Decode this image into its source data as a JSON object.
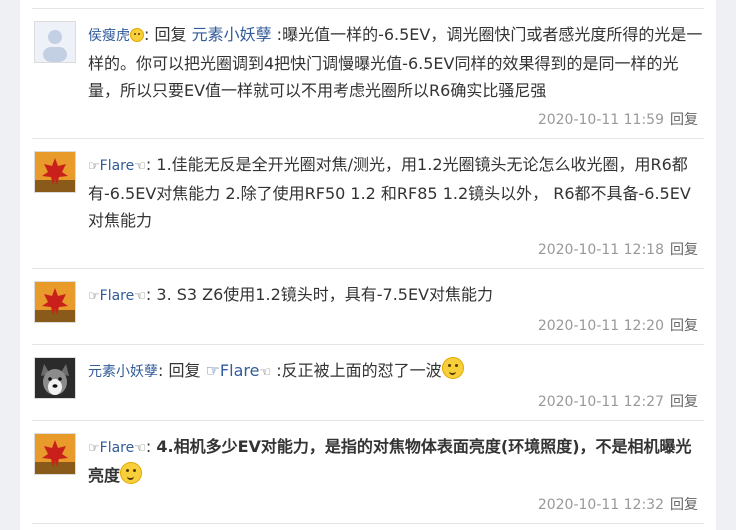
{
  "replies": [
    {
      "user": "侯瘦虎",
      "separator": ": ",
      "reply_word": "回复 ",
      "reply_target": "元素小妖孽",
      "text": " :曝光值一样的-6.5EV，调光圈快门或者感光度所得的光是一样的。你可以把光圈调到4把快门调慢曝光值-6.5EV同样的效果得到的是同一样的光量，所以只要EV值一样就可以不用考虑光圈所以R6确实比骚尼强",
      "timestamp": "2020-10-11 11:59",
      "reply_label": "回复"
    },
    {
      "user_prefix": "☞",
      "user": "Flare",
      "user_suffix": "☜",
      "separator": ": ",
      "text": "1.佳能无反是全开光圈对焦/测光，用1.2光圈镜头无论怎么收光圈，用R6都有-6.5EV对焦能力 2.除了使用RF50 1.2 和RF85 1.2镜头以外， R6都不具备-6.5EV对焦能力",
      "timestamp": "2020-10-11 12:18",
      "reply_label": "回复"
    },
    {
      "user_prefix": "☞",
      "user": "Flare",
      "user_suffix": "☜",
      "separator": ": ",
      "text": "3. S3 Z6使用1.2镜头时，具有-7.5EV对焦能力",
      "timestamp": "2020-10-11 12:20",
      "reply_label": "回复"
    },
    {
      "user": "元素小妖孽",
      "separator": ": ",
      "reply_word": "回复 ",
      "reply_target_prefix": "☞",
      "reply_target": "Flare",
      "reply_target_suffix": "☜",
      "text": " :反正被上面的怼了一波",
      "timestamp": "2020-10-11 12:27",
      "reply_label": "回复"
    },
    {
      "user_prefix": "☞",
      "user": "Flare",
      "user_suffix": "☜",
      "separator": ": ",
      "text": "4.相机多少EV对能力，是指的对焦物体表面亮度(环境照度)，不是相机曝光亮度",
      "timestamp": "2020-10-11 12:32",
      "reply_label": "回复"
    }
  ],
  "colors": {
    "link": "#315b99",
    "meta": "#999999",
    "border": "#e5e5e5"
  }
}
